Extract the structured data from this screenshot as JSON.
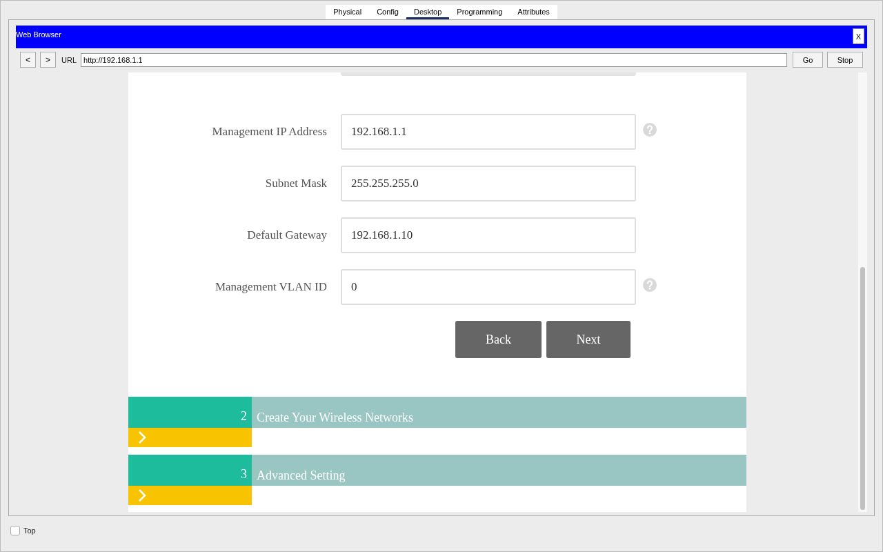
{
  "tabs": [
    {
      "label": "Physical",
      "selected": false
    },
    {
      "label": "Config",
      "selected": false
    },
    {
      "label": "Desktop",
      "selected": true
    },
    {
      "label": "Programming",
      "selected": false
    },
    {
      "label": "Attributes",
      "selected": false
    }
  ],
  "window": {
    "title": "Web Browser",
    "close": "X"
  },
  "browser": {
    "back": "<",
    "forward": ">",
    "url_label": "URL",
    "url": "http://192.168.1.1",
    "go": "Go",
    "stop": "Stop"
  },
  "form": {
    "fields": [
      {
        "label": "Management IP Address",
        "value": "192.168.1.1",
        "help": true
      },
      {
        "label": "Subnet Mask",
        "value": "255.255.255.0",
        "help": false
      },
      {
        "label": "Default Gateway",
        "value": "192.168.1.10",
        "help": false
      },
      {
        "label": "Management VLAN ID",
        "value": "0",
        "help": true
      }
    ],
    "buttons": [
      "Back",
      "Next"
    ]
  },
  "sections": [
    {
      "number": "2",
      "title": "Create Your Wireless Networks"
    },
    {
      "number": "3",
      "title": "Advanced Setting"
    }
  ],
  "footer": {
    "checkbox": {
      "label": "Top",
      "checked": false
    }
  }
}
